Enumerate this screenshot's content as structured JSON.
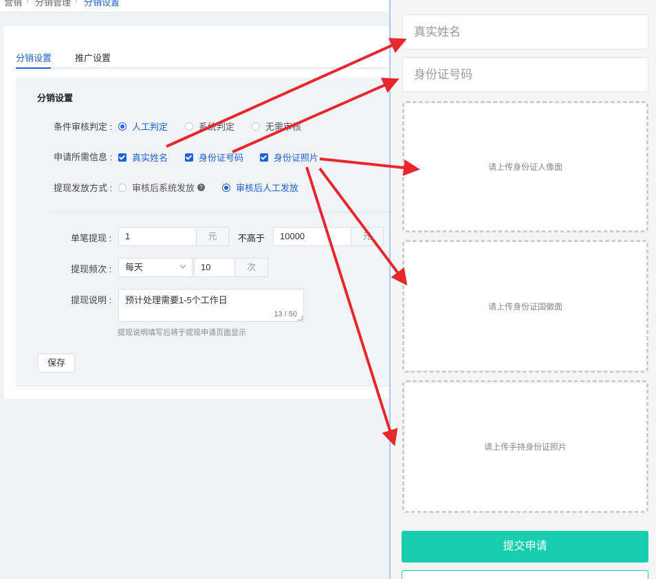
{
  "breadcrumb": [
    "营销",
    "分销管理",
    "分销设置"
  ],
  "tabs": [
    {
      "label": "分销设置"
    },
    {
      "label": "推广设置"
    }
  ],
  "settings": {
    "section_title": "分销设置",
    "audit": {
      "label": "条件审核判定 :",
      "options": [
        "人工判定",
        "系统判定",
        "无需审核"
      ],
      "selected": "人工判定"
    },
    "required_info": {
      "label": "申请所需信息 :",
      "options": [
        "真实姓名",
        "身份证号码",
        "身份证照片"
      ],
      "checked": [
        "真实姓名",
        "身份证号码",
        "身份证照片"
      ]
    },
    "payout": {
      "label": "提现发放方式 :",
      "options": [
        "审核后系统发放",
        "审核后人工发放"
      ],
      "selected": "审核后人工发放",
      "help_icon": "question-circle-icon"
    },
    "single_withdraw": {
      "label": "单笔提现 :",
      "min": "1",
      "unit": "元",
      "not_above": "不高于",
      "max": "10000",
      "max_unit": "元"
    },
    "frequency": {
      "label": "提现频次 :",
      "period": "每天",
      "count": "10",
      "unit": "次"
    },
    "description": {
      "label": "提现说明 :",
      "value": "预计处理需要1-5个工作日",
      "counter": "13 / 50",
      "hint": "提现说明填写后将于提现申请页面显示"
    },
    "save_label": "保存"
  },
  "mobile": {
    "name_placeholder": "真实姓名",
    "id_placeholder": "身份证号码",
    "upload_front": "请上传身份证人像面",
    "upload_back": "请上传身份证国徽面",
    "upload_hand": "请上传手持身份证照片",
    "submit_label": "提交申请"
  },
  "colors": {
    "accent": "#1a62d6",
    "submit": "#17cdb0",
    "arrow": "#e8272c"
  }
}
